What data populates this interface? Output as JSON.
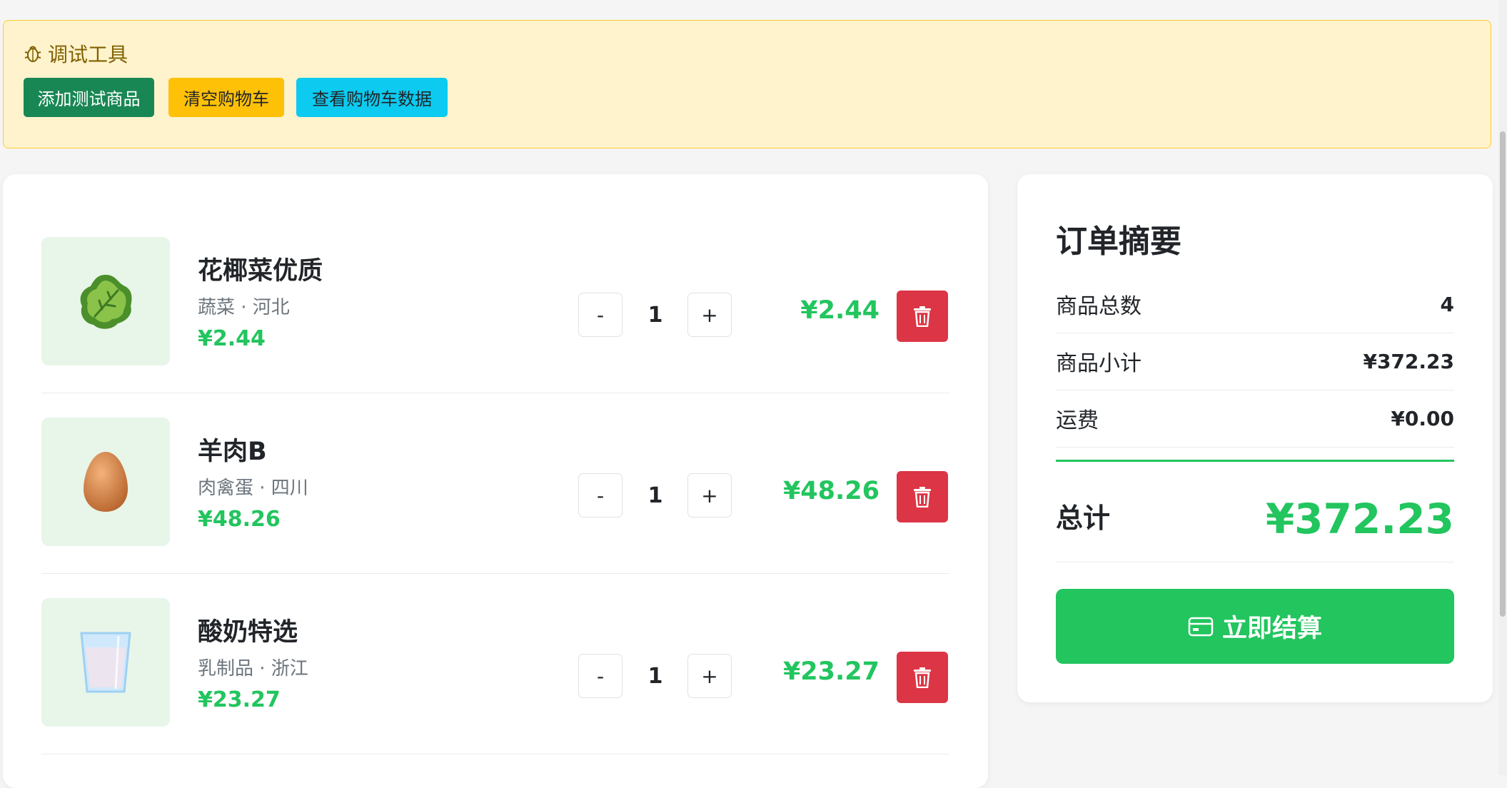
{
  "debug_tools": {
    "title": "调试工具",
    "buttons": {
      "add_test": "添加测试商品",
      "clear_cart": "清空购物车",
      "view_data": "查看购物车数据"
    }
  },
  "cart": {
    "items": [
      {
        "name": "花椰菜优质",
        "meta": "蔬菜 · 河北",
        "price": "¥2.44",
        "quantity": "1",
        "subtotal": "¥2.44",
        "minus": "-",
        "plus": "+",
        "icon": "lettuce-icon"
      },
      {
        "name": "羊肉B",
        "meta": "肉禽蛋 · 四川",
        "price": "¥48.26",
        "quantity": "1",
        "subtotal": "¥48.26",
        "minus": "-",
        "plus": "+",
        "icon": "egg-icon"
      },
      {
        "name": "酸奶特选",
        "meta": "乳制品 · 浙江",
        "price": "¥23.27",
        "quantity": "1",
        "subtotal": "¥23.27",
        "minus": "-",
        "plus": "+",
        "icon": "milk-glass-icon"
      }
    ]
  },
  "summary": {
    "title": "订单摘要",
    "rows": [
      {
        "label": "商品总数",
        "value": "4"
      },
      {
        "label": "商品小计",
        "value": "¥372.23"
      },
      {
        "label": "运费",
        "value": "¥0.00"
      }
    ],
    "total_label": "总计",
    "total_value": "¥372.23",
    "checkout_label": "立即结算"
  },
  "colors": {
    "accent_green": "#22c55e",
    "danger": "#dc3545",
    "debug_bg": "#fff3cd"
  }
}
